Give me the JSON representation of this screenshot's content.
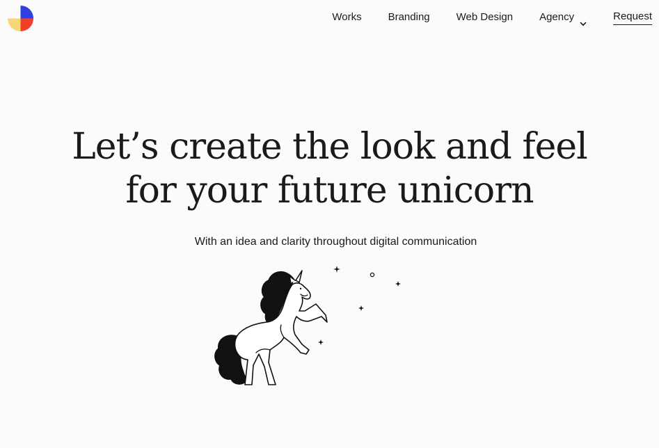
{
  "brand": {
    "logo_icon": "quartered-circle-logo-icon",
    "colors": {
      "blue": "#2f3fe0",
      "red": "#f0402a",
      "yellow": "#f7d774"
    }
  },
  "nav": {
    "items": [
      {
        "label": "Works"
      },
      {
        "label": "Branding"
      },
      {
        "label": "Web Design"
      },
      {
        "label": "Agency",
        "icon": "chevron-down-icon"
      }
    ],
    "cta": "Request"
  },
  "hero": {
    "title_line1": "Let’s create the look and feel",
    "title_line2": "for your future unicorn",
    "subtitle": "With an idea and clarity throughout digital communication",
    "illustration": "unicorn-illustration"
  }
}
